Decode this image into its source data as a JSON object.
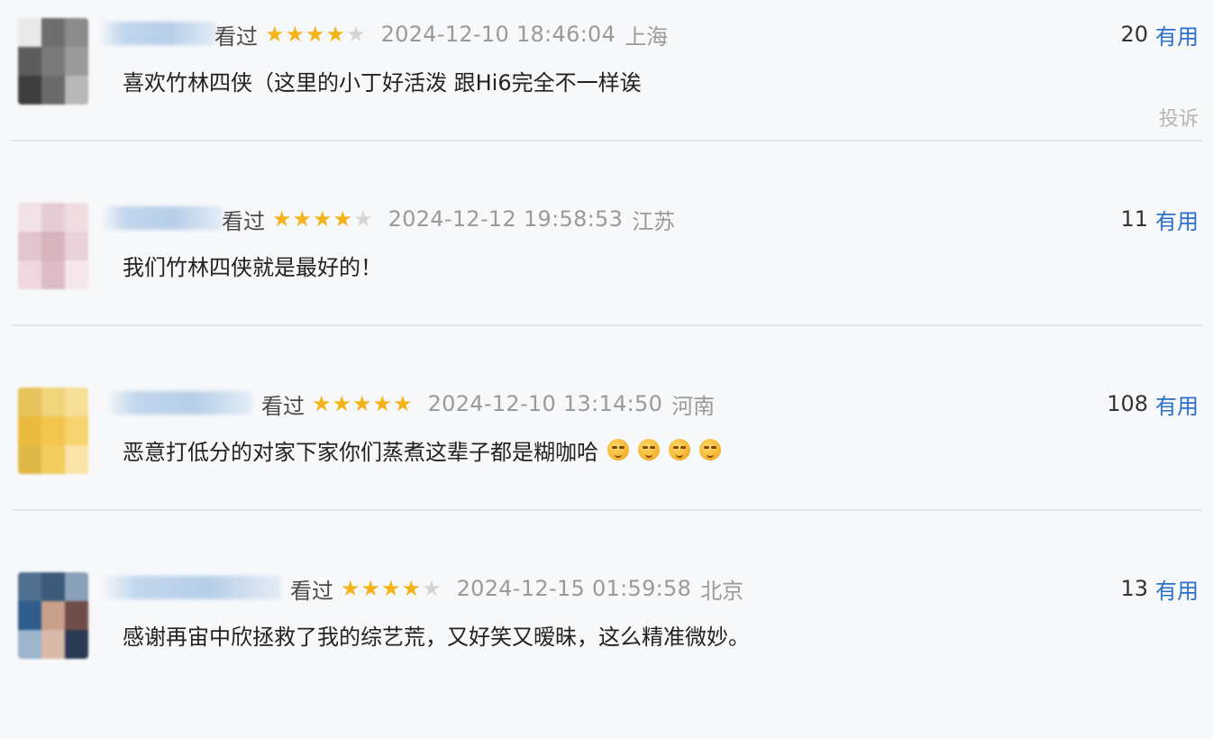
{
  "comments": [
    {
      "status": "看过",
      "rating": 4,
      "datetime": "2024-12-10 18:46:04",
      "location": "上海",
      "useful_count": "20",
      "useful_label": "有用",
      "text": "喜欢竹林四侠（这里的小丁好活泼 跟Hi6完全不一样诶",
      "report": "投诉",
      "emoji_count": 0
    },
    {
      "status": "看过",
      "rating": 4,
      "datetime": "2024-12-12 19:58:53",
      "location": "江苏",
      "useful_count": "11",
      "useful_label": "有用",
      "text": "我们竹林四侠就是最好的！",
      "report": "",
      "emoji_count": 0
    },
    {
      "status": "看过",
      "rating": 5,
      "datetime": "2024-12-10 13:14:50",
      "location": "河南",
      "useful_count": "108",
      "useful_label": "有用",
      "text": "恶意打低分的对家下家你们蒸煮这辈子都是糊咖哈",
      "report": "",
      "emoji_count": 4
    },
    {
      "status": "看过",
      "rating": 4,
      "datetime": "2024-12-15 01:59:58",
      "location": "北京",
      "useful_count": "13",
      "useful_label": "有用",
      "text": "感谢再宙中欣拯救了我的综艺荒，又好笑又暧昧，这么精准微妙。",
      "report": "",
      "emoji_count": 0
    }
  ],
  "colors": {
    "star_on": "#f5b31a",
    "star_off": "#d5d5d5",
    "link_blue": "#2a6fc9",
    "meta_gray": "#9a9a9a"
  },
  "icons": {
    "star": "star-icon",
    "emoji": "smirk-emoji-icon"
  }
}
